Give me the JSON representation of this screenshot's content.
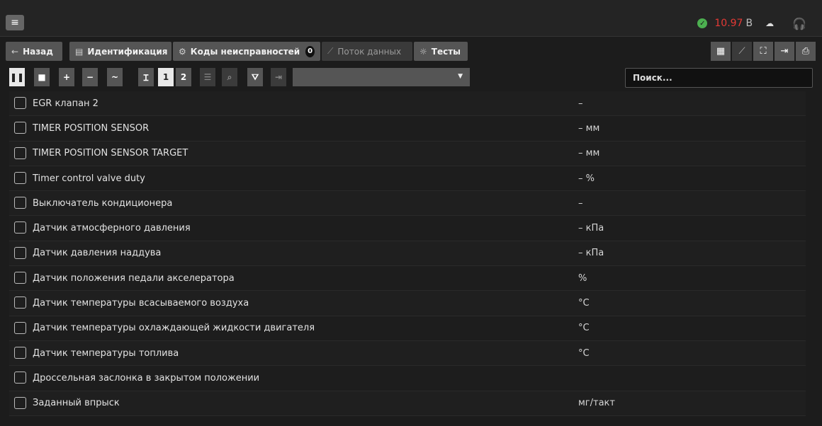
{
  "header": {
    "menu_icon": "hamburger-icon",
    "voltage_value": "10.97",
    "voltage_unit": "В"
  },
  "nav": {
    "back_label": "Назад",
    "identification_label": "Идентификация",
    "fault_codes_label": "Коды неисправностей",
    "fault_codes_count": "0",
    "data_stream_label": "Поток данных",
    "tests_label": "Тесты"
  },
  "toolbar": {
    "page_1": "1",
    "page_2": "2",
    "search_placeholder": "Поиск..."
  },
  "params": [
    {
      "name": "EGR клапан 2",
      "value": "–"
    },
    {
      "name": "TIMER POSITION SENSOR",
      "value": "– мм"
    },
    {
      "name": "TIMER POSITION SENSOR TARGET",
      "value": "– мм"
    },
    {
      "name": "Timer control valve duty",
      "value": "– %"
    },
    {
      "name": "Выключатель кондиционера",
      "value": "–"
    },
    {
      "name": "Датчик атмосферного давления",
      "value": "– кПа"
    },
    {
      "name": "Датчик давления наддува",
      "value": "– кПа"
    },
    {
      "name": "Датчик положения педали акселератора",
      "value": "%"
    },
    {
      "name": "Датчик температуры всасываемого воздуха",
      "value": "°C"
    },
    {
      "name": "Датчик температуры охлаждающей жидкости двигателя",
      "value": "°C"
    },
    {
      "name": "Датчик температуры топлива",
      "value": "°C"
    },
    {
      "name": "Дроссельная заслонка в закрытом положении",
      "value": ""
    },
    {
      "name": "Заданный впрыск",
      "value": "мг/такт"
    }
  ]
}
